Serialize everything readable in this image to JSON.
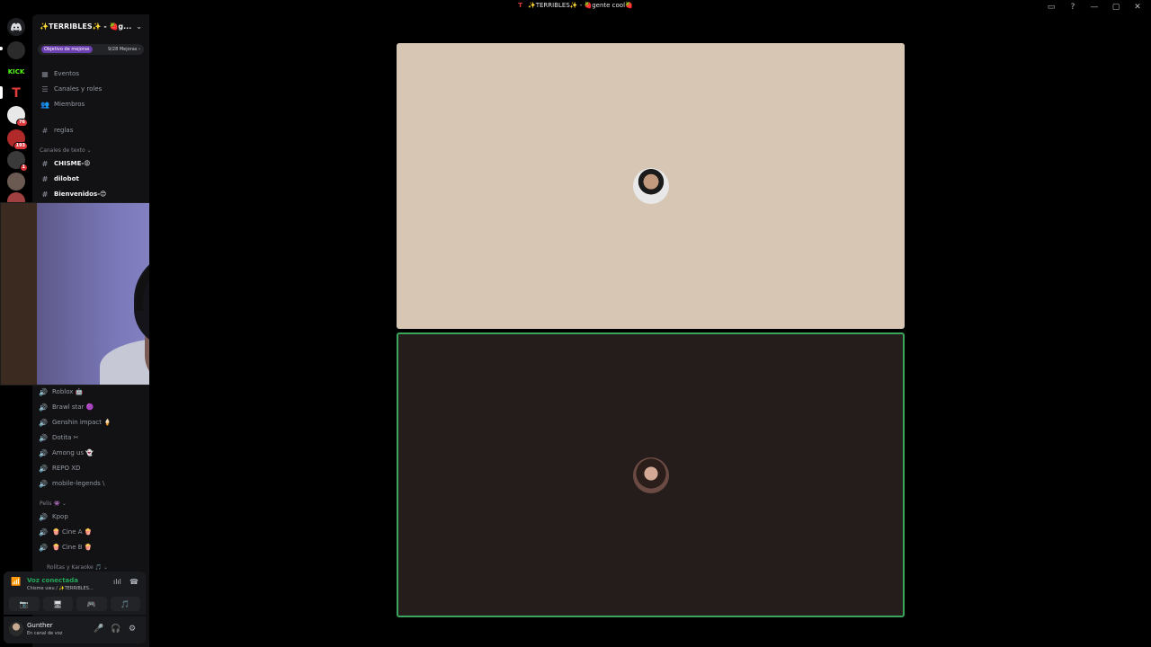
{
  "window": {
    "title": "✨TERRIBLES✨ - 🍓gente cool🍓",
    "logo_letter": "T",
    "controls": [
      "▭",
      "?",
      "—",
      "▢",
      "✕"
    ]
  },
  "rail": {
    "servers": [
      {
        "label": "",
        "badge": "",
        "color": "#1e1f22"
      },
      {
        "label": "",
        "badge": "",
        "color": "#2b2b2b"
      },
      {
        "label": "KICK",
        "badge": "",
        "color": "#000000"
      },
      {
        "label": "T",
        "badge": "",
        "color": "#000000"
      },
      {
        "label": "",
        "badge": "76",
        "color": "#e8e8e8"
      },
      {
        "label": "",
        "badge": "193",
        "color": "#b02a2a"
      },
      {
        "label": "",
        "badge": "1",
        "color": "#3a3a3a"
      },
      {
        "label": "",
        "badge": "",
        "color": "#6a5a52"
      },
      {
        "label": "",
        "badge": "",
        "color": "#a04040"
      }
    ]
  },
  "server": {
    "name": "✨TERRIBLES✨ - 🍓g...",
    "boost_goal": "Objetivo de mejoras",
    "boost_count": "9/28 Mejoras ›"
  },
  "nav": {
    "events": "Eventos",
    "channels_roles": "Canales y roles",
    "members": "Miembros"
  },
  "channels": {
    "rules": "reglas",
    "text_category": "Canales de texto ⌄",
    "text": [
      "CHISME-😡",
      "dilobot",
      "Bienvenidos-😊"
    ]
  },
  "voice_channels": [
    {
      "name": "Roblox 🤖"
    },
    {
      "name": "Brawl star 🟣"
    },
    {
      "name": "Genshin impact 🍦"
    },
    {
      "name": "Dotita ✂"
    },
    {
      "name": "Among us 👻"
    },
    {
      "name": "REPO XD"
    },
    {
      "name": "mobile-legends \\"
    }
  ],
  "pelis": {
    "category": "Pelis 👾 ⌄",
    "items": [
      "Kpop",
      "🍿 Cine A 🍿",
      "🍿 Cine B 🍿"
    ]
  },
  "karaoke_category": "Rolitas y Karaoke 🎵 ⌄",
  "voice_panel": {
    "status": "Voz conectada",
    "channel": "Chisme uwu / ✨TERRIBLES..."
  },
  "user": {
    "name": "Gunther",
    "status": "En canal de voz"
  },
  "colors": {
    "speaking": "#3ba55c",
    "tile1_bg": "#d6c6b3",
    "tile2_bg": "#241d1c"
  }
}
